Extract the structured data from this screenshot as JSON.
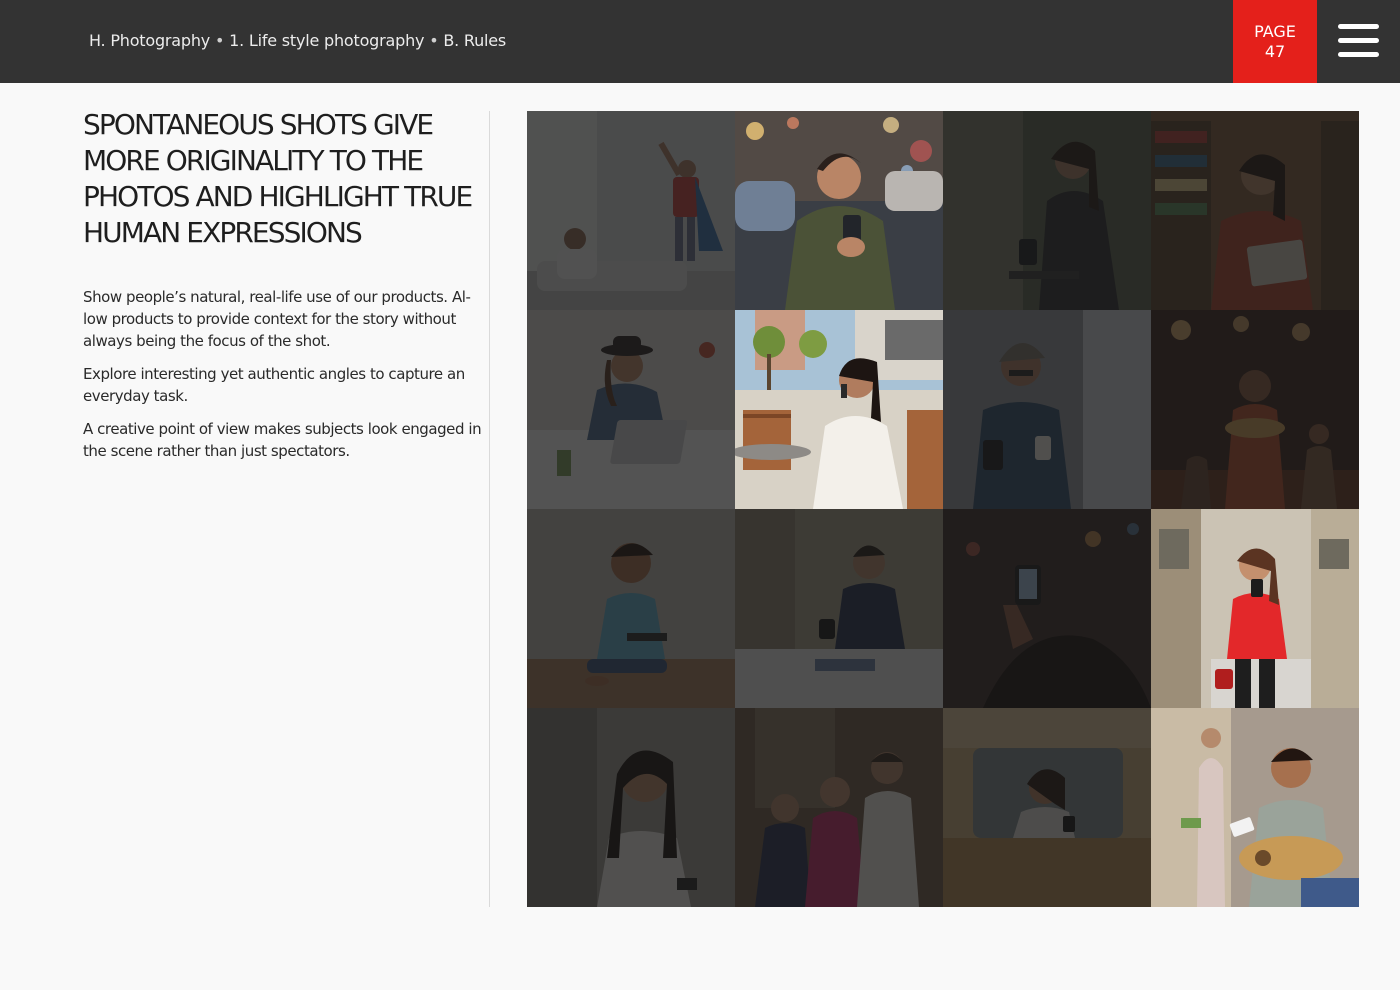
{
  "header": {
    "breadcrumb": {
      "section": "H. Photography",
      "separator": "•",
      "chapter": "1. Life style photography",
      "page": "B. Rules"
    },
    "page_label": "PAGE",
    "page_number": "47",
    "menu_icon": "hamburger-menu-icon"
  },
  "content": {
    "headline": "SPONTANEOUS SHOTS GIVE MORE ORIGINALITY TO THE PHOTOS AND HIGHLIGHT TRUE HUMAN EXPRESSIONS",
    "paragraphs": [
      "Show people’s natural, real-life use of our products. Al-low products to provide context for the story without always being the focus of the shot.",
      "Explore interesting yet authentic angles to capture an everyday task.",
      "A creative point of view makes subjects look engaged in the scene rather than just spectators."
    ]
  },
  "colors": {
    "header_bg": "#333333",
    "page_badge": "#e4201b",
    "page_bg": "#f9f9f9",
    "text": "#1e1e1e"
  },
  "photo_grid": {
    "columns": 4,
    "rows": 4,
    "highlighted_tiles": [
      "woman-with-phone-night-street",
      "woman-on-phone-cafe-terrace",
      "woman-red-top-walking-with-phone",
      "musician-with-tablet"
    ]
  }
}
